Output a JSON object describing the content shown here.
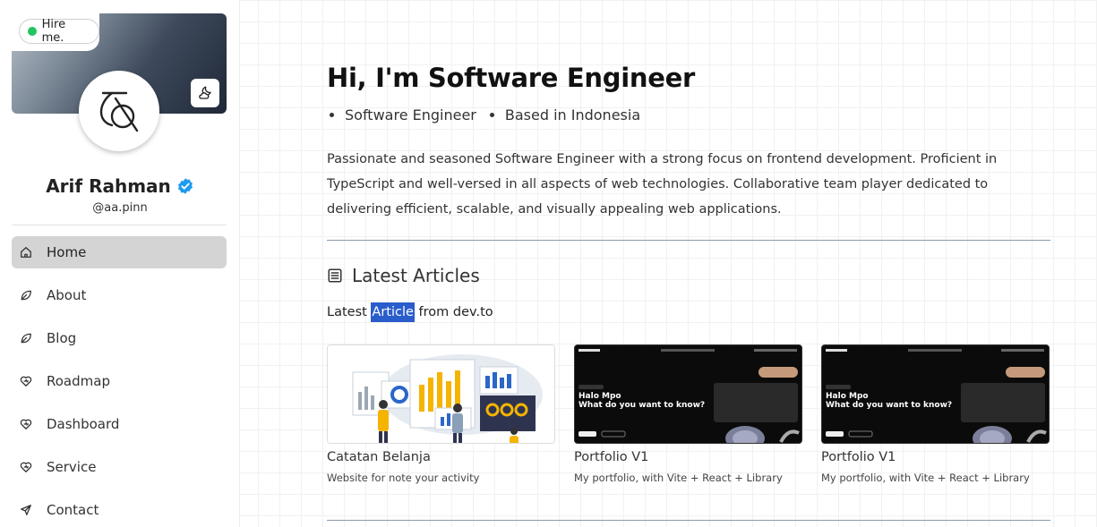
{
  "profile": {
    "hire_label": "Hire me.",
    "name": "Arif Rahman",
    "handle": "@aa.pinn",
    "verified_color": "#1d9bf0",
    "status_color": "#22c55e"
  },
  "nav": {
    "items": [
      {
        "label": "Home",
        "icon": "home-icon",
        "active": true
      },
      {
        "label": "About",
        "icon": "leaf-icon"
      },
      {
        "label": "Blog",
        "icon": "leaf-icon"
      },
      {
        "label": "Roadmap",
        "icon": "heart-icon"
      },
      {
        "label": "Dashboard",
        "icon": "heart-icon"
      },
      {
        "label": "Service",
        "icon": "heart-icon"
      },
      {
        "label": "Contact",
        "icon": "send-icon"
      }
    ]
  },
  "hero": {
    "title": "Hi, I'm Software Engineer",
    "tags": [
      "Software Engineer",
      "Based in Indonesia"
    ],
    "intro": "Passionate and seasoned Software Engineer with a strong focus on frontend development. Proficient in TypeScript and well-versed in all aspects of web technologies. Collaborative team player dedicated to delivering efficient, scalable, and visually appealing web applications."
  },
  "articles": {
    "title": "Latest Articles",
    "subtitle_pre": "Latest ",
    "subtitle_highlight": "Article",
    "subtitle_post": " from dev.to",
    "highlight_color": "#2a5dcc",
    "cards": [
      {
        "title": "Catatan Belanja",
        "desc": "Website for note your activity",
        "thumb_heading": ""
      },
      {
        "title": "Portfolio V1",
        "desc": "My portfolio, with Vite + React + Library",
        "thumb_heading": "Halo Mpo",
        "thumb_sub": "What do you want to know?"
      },
      {
        "title": "Portfolio V1",
        "desc": "My portfolio, with Vite + React + Library",
        "thumb_heading": "Halo Mpo",
        "thumb_sub": "What do you want to know?"
      }
    ]
  }
}
